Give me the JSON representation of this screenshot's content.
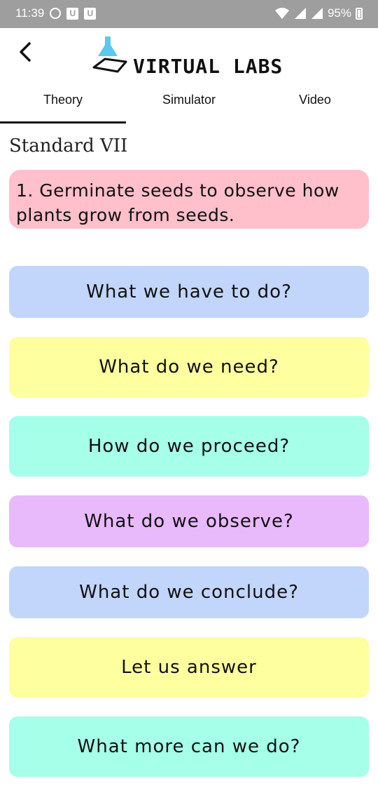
{
  "status_bar": {
    "time": "11:39",
    "battery": "95%"
  },
  "header": {
    "logo_text": "VIRTUAL LABS"
  },
  "tabs": [
    {
      "label": "Theory",
      "active": true
    },
    {
      "label": "Simulator",
      "active": false
    },
    {
      "label": "Video",
      "active": false
    }
  ],
  "standard_label": "Standard VII",
  "experiment": {
    "title": "1. Germinate seeds to observe how plants grow from seeds."
  },
  "sections": [
    {
      "label": "What we have to do?",
      "color": "#c2d5fb"
    },
    {
      "label": "What do we need?",
      "color": "#feff9f"
    },
    {
      "label": "How do we proceed?",
      "color": "#a5ffe9"
    },
    {
      "label": "What do we observe?",
      "color": "#e8b9fb"
    },
    {
      "label": "What do we conclude?",
      "color": "#c2d5fb"
    },
    {
      "label": "Let us answer",
      "color": "#feff9f"
    },
    {
      "label": "What more can we do?",
      "color": "#a5ffe9"
    }
  ]
}
